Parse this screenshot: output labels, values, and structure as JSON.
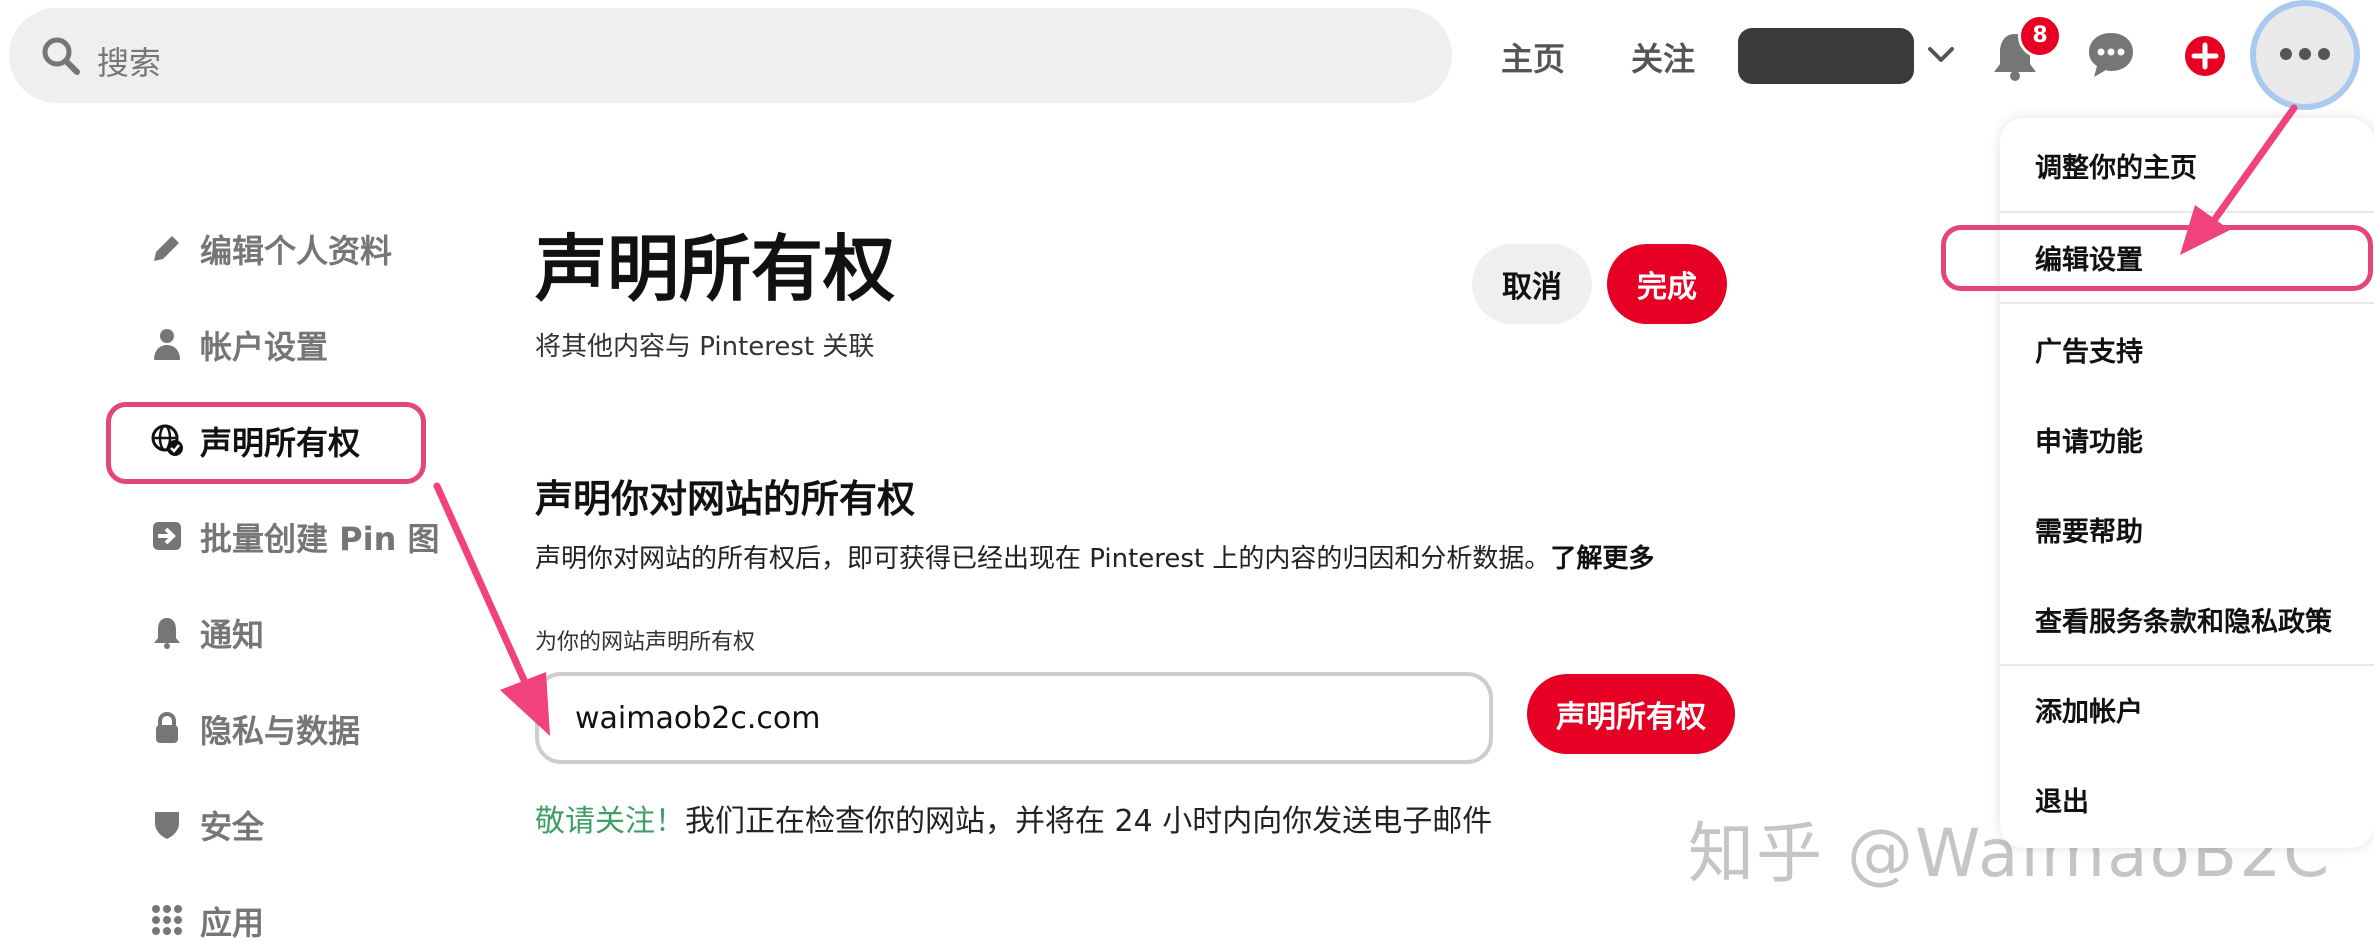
{
  "search": {
    "placeholder": "搜索"
  },
  "nav": {
    "home": "主页",
    "following": "关注"
  },
  "notifications": {
    "badge_count": "8"
  },
  "sidebar": {
    "items": [
      {
        "label": "编辑个人资料",
        "icon": "pencil-icon"
      },
      {
        "label": "帐户设置",
        "icon": "person-icon"
      },
      {
        "label": "声明所有权",
        "icon": "globe-check-icon",
        "active": true
      },
      {
        "label": "批量创建 Pin 图",
        "icon": "import-icon"
      },
      {
        "label": "通知",
        "icon": "bell-icon"
      },
      {
        "label": "隐私与数据",
        "icon": "lock-icon"
      },
      {
        "label": "安全",
        "icon": "shield-icon"
      },
      {
        "label": "应用",
        "icon": "grid-icon"
      }
    ]
  },
  "main": {
    "title": "声明所有权",
    "subtitle": "将其他内容与 Pinterest 关联",
    "cancel_label": "取消",
    "done_label": "完成",
    "section_title": "声明你对网站的所有权",
    "section_desc": "声明你对网站的所有权后，即可获得已经出现在 Pinterest 上的内容的归因和分析数据。",
    "learn_more": "了解更多",
    "field_label": "为你的网站声明所有权",
    "field_value": "waimaob2c.com",
    "claim_button": "声明所有权",
    "notice_hint": "敬请关注！",
    "notice_text": "我们正在检查你的网站，并将在 24 小时内向你发送电子邮件"
  },
  "menu": {
    "items": [
      "调整你的主页",
      "编辑设置",
      "广告支持",
      "申请功能",
      "需要帮助",
      "查看服务条款和隐私政策",
      "添加帐户",
      "退出"
    ]
  },
  "watermark": "知乎 @WaimaoB2C",
  "colors": {
    "accent_red": "#e60023",
    "highlight_pink": "#e2467c",
    "notice_green": "#3f9f67"
  }
}
